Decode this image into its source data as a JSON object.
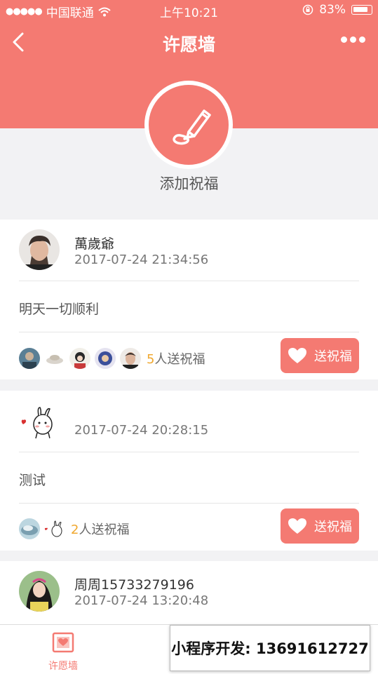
{
  "status_bar": {
    "carrier": "中国联通",
    "time": "上午10:21",
    "battery": "83%"
  },
  "nav": {
    "title": "许愿墙"
  },
  "add_wish": {
    "label": "添加祝福"
  },
  "posts": [
    {
      "username": "萬歲爺",
      "time": "2017-07-24 21:34:56",
      "message": "明天一切顺利",
      "bless_count": "5",
      "bless_suffix": "人送祝福",
      "button_label": "送祝福"
    },
    {
      "username": "",
      "time": "2017-07-24 20:28:15",
      "message": "测试",
      "bless_count": "2",
      "bless_suffix": "人送祝福",
      "button_label": "送祝福"
    },
    {
      "username": "周周15733279196",
      "time": "2017-07-24 13:20:48"
    }
  ],
  "tabbar": {
    "tab1_label": "许愿墙"
  },
  "watermark": {
    "text": "小程序开发:  13691612727"
  },
  "colors": {
    "accent": "#f47a72",
    "count": "#f0a830"
  }
}
